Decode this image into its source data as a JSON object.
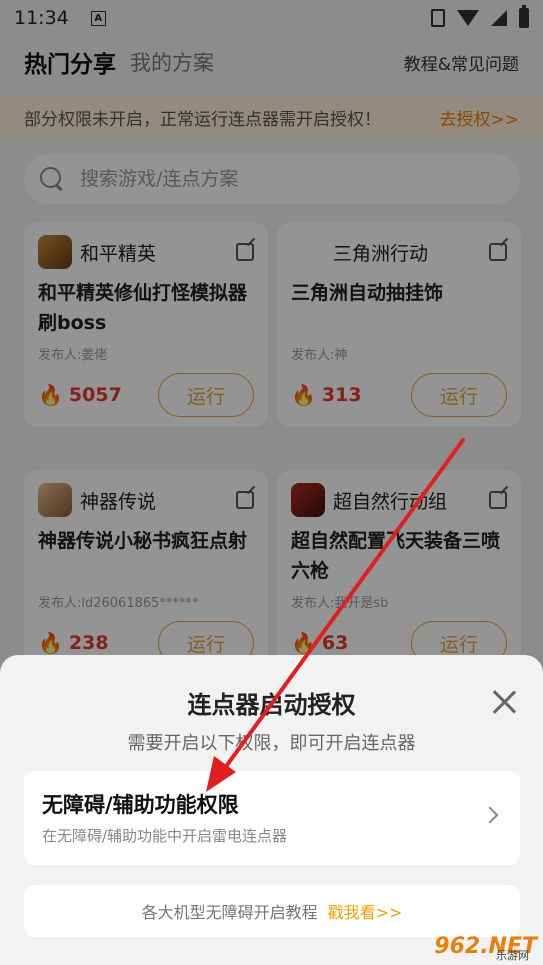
{
  "status": {
    "time": "11:34",
    "a_label": "A"
  },
  "header": {
    "active_tab": "热门分享",
    "tab2": "我的方案",
    "help": "教程&常见问题"
  },
  "notice": {
    "message": "部分权限未开启，正常运行连点器需开启授权！",
    "link": "去授权>>"
  },
  "search": {
    "placeholder": "搜索游戏/连点方案"
  },
  "cards": [
    {
      "game": "和平精英",
      "title": "和平精英修仙打怪模拟器刷boss",
      "publisher": "发布人:姜佬",
      "hot": "5057",
      "run": "运行"
    },
    {
      "game": "三角洲行动",
      "title": "三角洲自动抽挂饰",
      "publisher": "发布人:神",
      "hot": "313",
      "run": "运行"
    },
    {
      "game": "神器传说",
      "title": "神器传说小秘书疯狂点射",
      "publisher": "发布人:ld26061865******",
      "hot": "238",
      "run": "运行"
    },
    {
      "game": "超自然行动组",
      "title": "超自然配置飞天装备三喷六枪",
      "publisher": "发布人:我开是sb",
      "hot": "63",
      "run": "运行"
    }
  ],
  "sheet": {
    "title": "连点器启动授权",
    "subtitle": "需要开启以下权限，即可开启连点器",
    "perm_title": "无障碍/辅助功能权限",
    "perm_desc": "在无障碍/辅助功能中开启雷电连点器",
    "tutorial_label": "各大机型无障碍开启教程",
    "tutorial_link": "戳我看>>"
  },
  "watermark": {
    "brand": "962.NET",
    "sub": "乐游网"
  },
  "colors": {
    "accent": "#e6a531",
    "hot": "#e23b2b",
    "arrow": "#e02020"
  }
}
